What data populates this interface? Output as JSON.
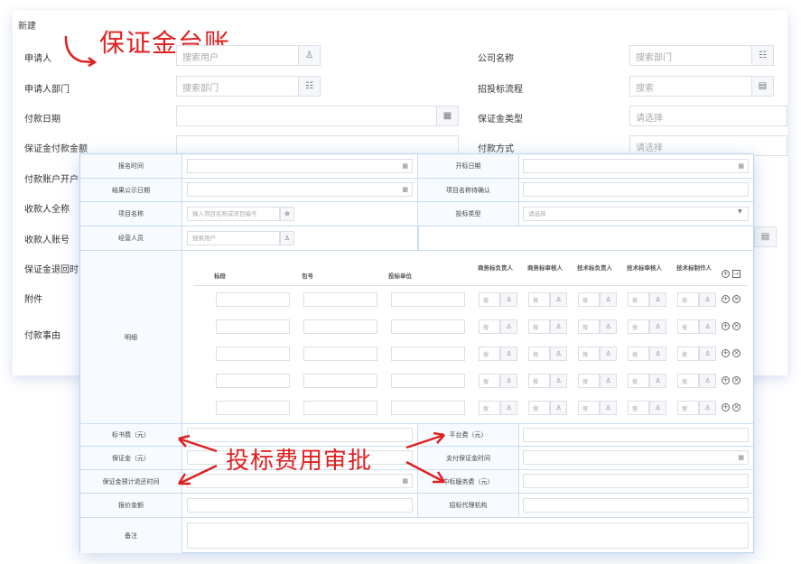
{
  "background_form": {
    "title": "新建",
    "annotation": "保证金台账",
    "left_labels": [
      "申请人",
      "申请人部门",
      "付款日期",
      "保证金付款金额",
      "付款账户开户",
      "收款人全称",
      "收款人账号",
      "保证金退回时",
      "附件",
      "付款事由"
    ],
    "right_labels": [
      "公司名称",
      "招投标流程",
      "保证金类型",
      "付款方式"
    ],
    "applicant_placeholder": "搜索用户",
    "dept_placeholder": "搜索部门",
    "company_placeholder": "搜索部门",
    "process_placeholder": "搜索",
    "type_placeholder": "请选择",
    "pay_method_placeholder": "请选择"
  },
  "front_form": {
    "annotation": "投标费用审批",
    "labels": {
      "signup_time": "报名时间",
      "open_date": "开标日期",
      "result_date": "结果公示日期",
      "project_confirm": "项目名称待确认",
      "project_name": "项目名称",
      "bid_type": "投标类型",
      "handler": "经营人员",
      "detail": "明细",
      "doc_fee": "标书费（元）",
      "platform_fee": "平台费（元）",
      "deposit": "保证金（元）",
      "deposit_pay_time": "支付保证金时间",
      "deposit_return_time": "保证金预计退还时间",
      "service_fee": "中标服务费（元）",
      "quote_amount": "报价金额",
      "agency": "招标代理机构",
      "remark": "备注"
    },
    "project_placeholder": "输入项目名称或项目编号",
    "handler_placeholder": "搜索用户",
    "bid_type_placeholder": "请选择",
    "detail_headers": [
      "标段",
      "包号",
      "投标单位",
      "商务标负责人",
      "商务标审核人",
      "技术标负责人",
      "技术标审核人",
      "技术标制作人"
    ],
    "small_search": "搜",
    "rows": 5
  }
}
